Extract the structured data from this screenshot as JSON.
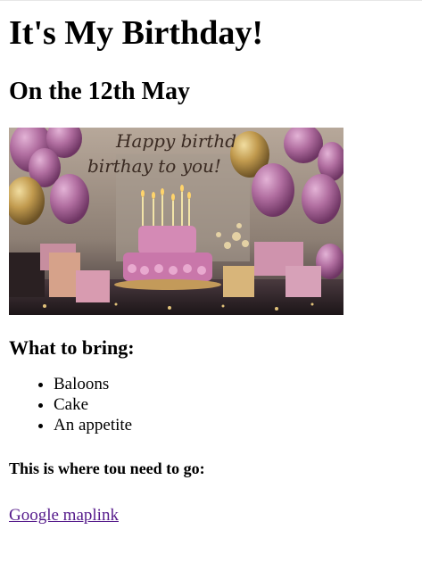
{
  "page": {
    "title": "It's My Birthday!",
    "subtitle": "On the 12th May",
    "hero_image": {
      "caption_line1": "Happy birthd",
      "caption_line2": "birthay to you!"
    },
    "bring_heading": "What to bring:",
    "bring_items": [
      "Baloons",
      "Cake",
      "An appetite"
    ],
    "directions_heading": "This is where tou need to go:",
    "map_link_label": "Google maplink"
  },
  "colors": {
    "link_visited": "#551a8b",
    "balloon_purple": "#b86fa6",
    "balloon_gold": "#c7a45a",
    "cake_pink": "#d985b8",
    "wall": "#9b8e83"
  }
}
